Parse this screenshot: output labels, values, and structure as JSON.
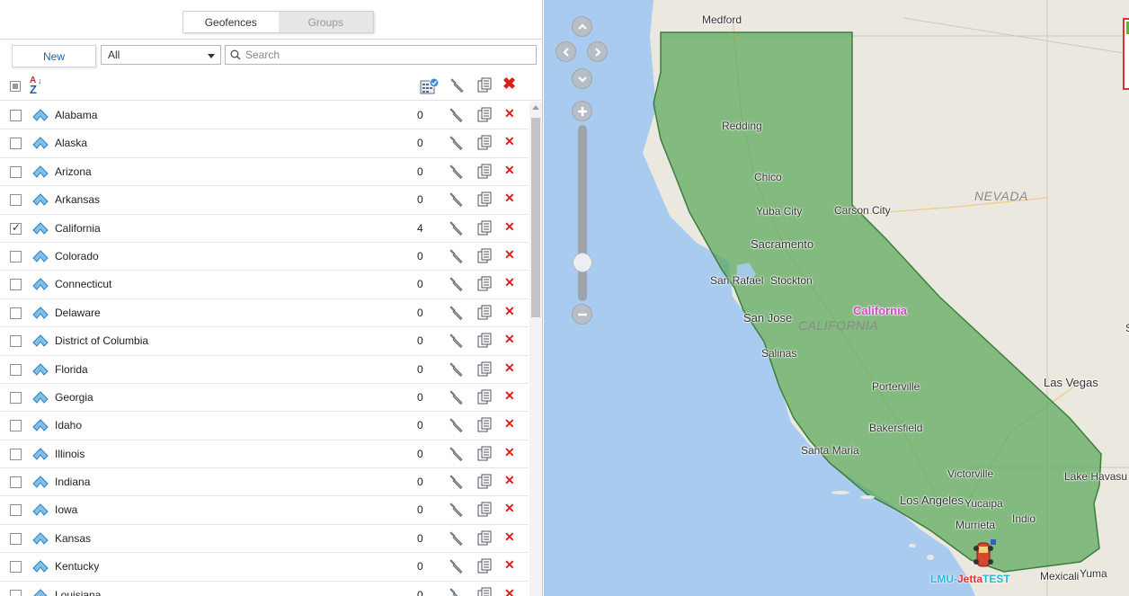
{
  "tabs": [
    {
      "label": "Geofences",
      "active": true
    },
    {
      "label": "Groups",
      "active": false
    }
  ],
  "toolbar": {
    "new_label": "New",
    "filter_value": "All",
    "search_placeholder": "Search"
  },
  "geofences": [
    {
      "name": "Alabama",
      "count": "0",
      "checked": false
    },
    {
      "name": "Alaska",
      "count": "0",
      "checked": false
    },
    {
      "name": "Arizona",
      "count": "0",
      "checked": false
    },
    {
      "name": "Arkansas",
      "count": "0",
      "checked": false
    },
    {
      "name": "California",
      "count": "4",
      "checked": true
    },
    {
      "name": "Colorado",
      "count": "0",
      "checked": false
    },
    {
      "name": "Connecticut",
      "count": "0",
      "checked": false
    },
    {
      "name": "Delaware",
      "count": "0",
      "checked": false
    },
    {
      "name": "District of Columbia",
      "count": "0",
      "checked": false
    },
    {
      "name": "Florida",
      "count": "0",
      "checked": false
    },
    {
      "name": "Georgia",
      "count": "0",
      "checked": false
    },
    {
      "name": "Idaho",
      "count": "0",
      "checked": false
    },
    {
      "name": "Illinois",
      "count": "0",
      "checked": false
    },
    {
      "name": "Indiana",
      "count": "0",
      "checked": false
    },
    {
      "name": "Iowa",
      "count": "0",
      "checked": false
    },
    {
      "name": "Kansas",
      "count": "0",
      "checked": false
    },
    {
      "name": "Kentucky",
      "count": "0",
      "checked": false
    },
    {
      "name": "Louisiana",
      "count": "0",
      "checked": false
    }
  ],
  "map": {
    "cities": {
      "medford": "Medford",
      "redding": "Redding",
      "chico": "Chico",
      "yuba_city": "Yuba City",
      "carson_city": "Carson City",
      "sacramento": "Sacramento",
      "san_rafael": "San Rafael",
      "stockton": "Stockton",
      "san_jose": "San Jose",
      "salinas": "Salinas",
      "porterville": "Porterville",
      "las_vegas": "Las Vegas",
      "bakersfield": "Bakersfield",
      "santa_maria": "Santa Maria",
      "victorville": "Victorville",
      "lake_havasu": "Lake Havasu",
      "los_angeles": "Los Angeles",
      "yucaipa": "Yucaipa",
      "indio": "Indio",
      "murrieta": "Murrieta",
      "mexicali": "Mexicali",
      "yuma": "Yuma",
      "st_fragment": "St"
    },
    "state_labels": {
      "nevada": "NEVADA",
      "california": "CALIFORNIA"
    },
    "geofence_label": "California",
    "vehicle_label_part1": "LMU-",
    "vehicle_label_part2": "Jetta",
    "vehicle_label_part3": "TEST",
    "colors": {
      "geofence_fill": "#5aa85a",
      "geofence_stroke": "#3d7d3d",
      "water": "#a9cbef",
      "land": "#ebe9df"
    }
  }
}
